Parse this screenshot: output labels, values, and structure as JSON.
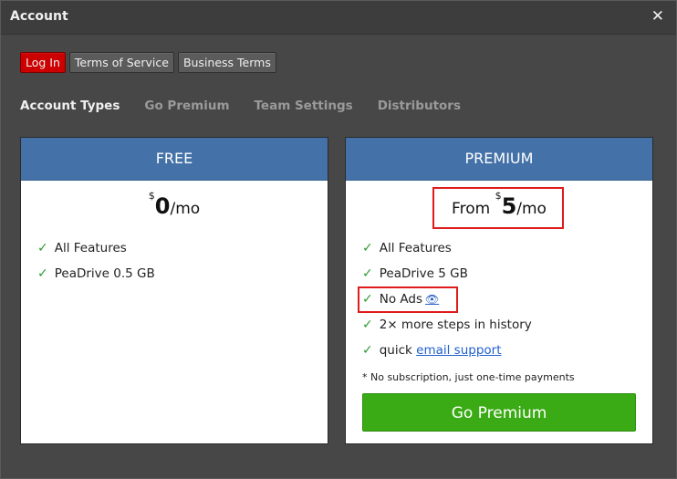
{
  "window": {
    "title": "Account",
    "close_glyph": "✕"
  },
  "top_buttons": [
    {
      "label": "Log In",
      "accent": "#cc0000"
    },
    {
      "label": "Terms of Service"
    },
    {
      "label": "Business Terms"
    }
  ],
  "tabs": [
    {
      "label": "Account Types",
      "active": true
    },
    {
      "label": "Go Premium"
    },
    {
      "label": "Team Settings"
    },
    {
      "label": "Distributors"
    }
  ],
  "plans": {
    "free": {
      "header": "FREE",
      "currency": "$",
      "amount": "0",
      "per": "/mo",
      "features": [
        {
          "text": "All Features"
        },
        {
          "text": "PeaDrive 0.5 GB"
        }
      ]
    },
    "premium": {
      "header": "PREMIUM",
      "price_prefix": "From ",
      "currency": "$",
      "amount": "5",
      "per": "/mo",
      "features": [
        {
          "text": "All Features"
        },
        {
          "text": "PeaDrive 5 GB"
        },
        {
          "text": "No Ads",
          "icon": "eye-icon"
        },
        {
          "text": "2× more steps in history"
        },
        {
          "text_prefix": "quick ",
          "link": "email support"
        }
      ],
      "note": "* No subscription, just one-time payments",
      "cta": "Go Premium"
    }
  },
  "colors": {
    "header_blue": "#4472a8",
    "check_green": "#2f9a2f",
    "cta_green": "#3aab14",
    "highlight_red": "#e01b1b"
  },
  "check_glyph": "✓",
  "eye_glyph": "👁"
}
